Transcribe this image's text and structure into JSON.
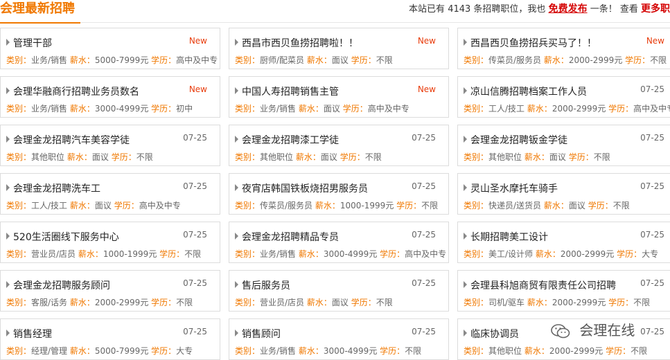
{
  "header": {
    "title": "会理最新招聘",
    "stat_prefix": "本站已有",
    "job_count": "4143",
    "stat_mid": "条招聘职位，我也",
    "publish_link": "免费发布",
    "stat_after": "一条！ 查看",
    "more_link": "更多职"
  },
  "labels": {
    "category": "类别：",
    "salary": "薪水：",
    "education": "学历："
  },
  "jobs": [
    {
      "title": "管理干部",
      "tag": "New",
      "category": "业务/销售",
      "salary": "5000-7999元",
      "education": "高中及中专"
    },
    {
      "title": "西昌市西贝鱼捞招聘啦！！",
      "tag": "New",
      "category": "厨师/配菜员",
      "salary": "面议",
      "education": "不限"
    },
    {
      "title": "西昌西贝鱼捞招兵买马了！！",
      "tag": "New",
      "category": "传菜员/服务员",
      "salary": "2000-2999元",
      "education": "不限"
    },
    {
      "title": "会理华融商行招聘业务员数名",
      "tag": "New",
      "category": "业务/销售",
      "salary": "3000-4999元",
      "education": "初中"
    },
    {
      "title": "中国人寿招聘销售主管",
      "tag": "New",
      "category": "业务/销售",
      "salary": "面议",
      "education": "高中及中专"
    },
    {
      "title": "凉山信腾招聘档案工作人员",
      "tag": "07-25",
      "category": "工人/技工",
      "salary": "2000-2999元",
      "education": "高中及中专"
    },
    {
      "title": "会理金龙招聘汽车美容学徒",
      "tag": "07-25",
      "category": "其他职位",
      "salary": "面议",
      "education": "不限"
    },
    {
      "title": "会理金龙招聘漆工学徒",
      "tag": "07-25",
      "category": "其他职位",
      "salary": "面议",
      "education": "不限"
    },
    {
      "title": "会理金龙招聘钣金学徒",
      "tag": "07-25",
      "category": "其他职位",
      "salary": "面议",
      "education": "不限"
    },
    {
      "title": "会理金龙招聘洗车工",
      "tag": "07-25",
      "category": "工人/技工",
      "salary": "面议",
      "education": "高中及中专"
    },
    {
      "title": "夜宵店韩国铁板烧招男服务员",
      "tag": "07-25",
      "category": "传菜员/服务员",
      "salary": "1000-1999元",
      "education": "不限"
    },
    {
      "title": "灵山圣水摩托车骑手",
      "tag": "07-25",
      "category": "快递员/送货员",
      "salary": "面议",
      "education": "不限"
    },
    {
      "title": "520生活圈线下服务中心",
      "tag": "07-25",
      "category": "营业员/店员",
      "salary": "1000-1999元",
      "education": "不限"
    },
    {
      "title": "会理金龙招聘精品专员",
      "tag": "07-25",
      "category": "业务/销售",
      "salary": "3000-4999元",
      "education": "高中及中专"
    },
    {
      "title": "长期招聘美工设计",
      "tag": "07-25",
      "category": "美工/设计师",
      "salary": "2000-2999元",
      "education": "大专"
    },
    {
      "title": "会理金龙招聘服务顾问",
      "tag": "07-25",
      "category": "客服/话务",
      "salary": "2000-2999元",
      "education": "不限"
    },
    {
      "title": "售后服务员",
      "tag": "07-25",
      "category": "营业员/店员",
      "salary": "面议",
      "education": "不限"
    },
    {
      "title": "会理县科旭商贸有限责任公司招聘",
      "tag": "07-25",
      "category": "司机/驱车",
      "salary": "2000-2999元",
      "education": "不限"
    },
    {
      "title": "销售经理",
      "tag": "07-25",
      "category": "经理/管理",
      "salary": "5000-7999元",
      "education": "大专"
    },
    {
      "title": "销售顾问",
      "tag": "07-25",
      "category": "业务/销售",
      "salary": "3000-4999元",
      "education": "不限"
    },
    {
      "title": "临床协调员",
      "tag": "07-25",
      "category": "其他职位",
      "salary": "2000-2999元",
      "education": "不限"
    }
  ],
  "watermark": {
    "text": "会理在线",
    "icon": "wechat-icon"
  },
  "colors": {
    "accent": "#f07800",
    "new_tag": "#e83c0c",
    "link_red": "#d40000"
  }
}
